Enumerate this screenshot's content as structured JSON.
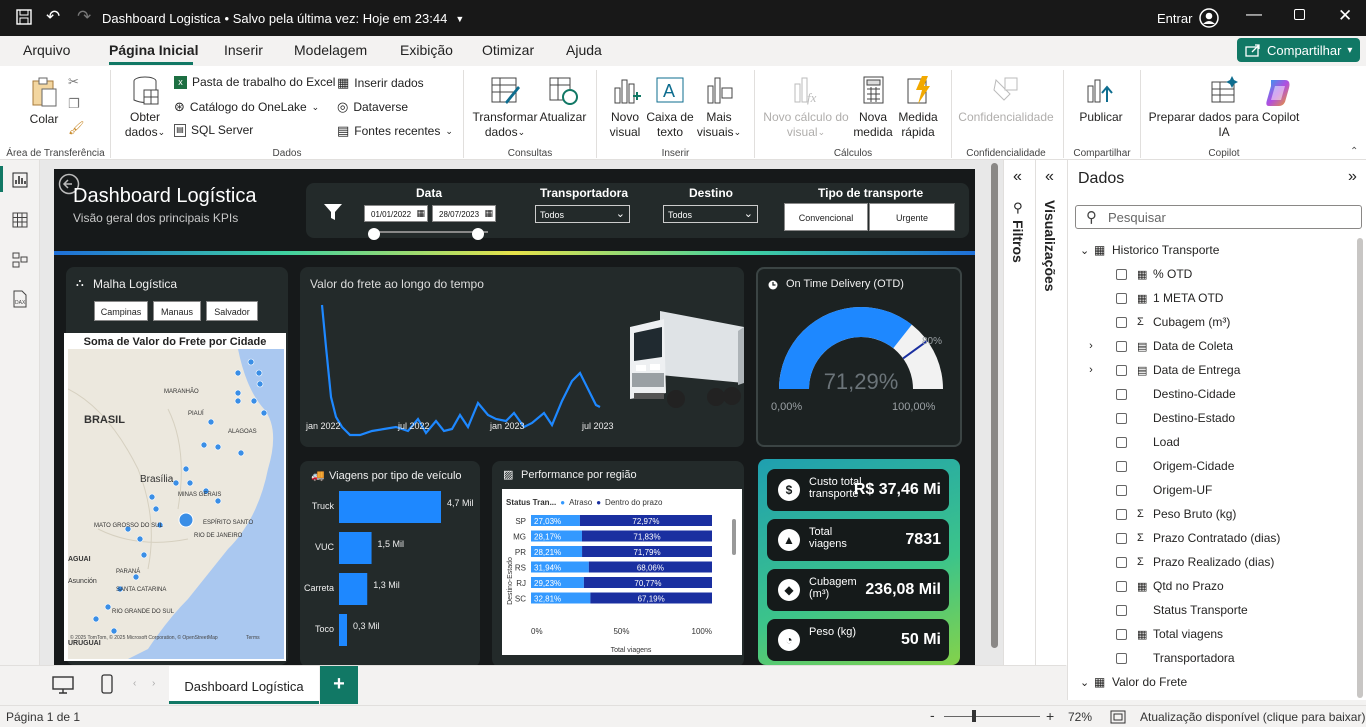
{
  "titlebar": {
    "title": "Dashboard Logistica",
    "saved": "• Salvo pela última vez: Hoje em 23:44",
    "signin": "Entrar"
  },
  "menu": {
    "items": [
      "Arquivo",
      "Página Inicial",
      "Inserir",
      "Modelagem",
      "Exibição",
      "Otimizar",
      "Ajuda"
    ],
    "active": "Página Inicial",
    "share": "Compartilhar"
  },
  "ribbon": {
    "paste": "Colar",
    "grp_clipboard": "Área de Transferência",
    "get_data_1": "Obter",
    "get_data_2": "dados",
    "excel": "Pasta de trabalho do Excel",
    "onelake": "Catálogo do OneLake",
    "sql": "SQL Server",
    "insert_data": "Inserir dados",
    "dataverse": "Dataverse",
    "recent": "Fontes recentes",
    "grp_data": "Dados",
    "transform_1": "Transformar",
    "transform_2": "dados",
    "refresh": "Atualizar",
    "grp_queries": "Consultas",
    "new_visual_1": "Novo",
    "new_visual_2": "visual",
    "textbox_1": "Caixa de",
    "textbox_2": "texto",
    "more_visuals_1": "Mais",
    "more_visuals_2": "visuais",
    "grp_insert": "Inserir",
    "new_calc_1": "Novo cálculo do",
    "new_calc_2": "visual",
    "new_measure_1": "Nova",
    "new_measure_2": "medida",
    "quick_measure_1": "Medida",
    "quick_measure_2": "rápida",
    "grp_calc": "Cálculos",
    "sensitivity": "Confidencialidade",
    "grp_sensitivity": "Confidencialidade",
    "publish": "Publicar",
    "grp_share": "Compartilhar",
    "copilot_1": "Preparar dados para Copilot",
    "copilot_2": "IA",
    "grp_copilot": "Copilot"
  },
  "report": {
    "title": "Dashboard Logística",
    "subtitle": "Visão geral dos principais KPIs",
    "filters": {
      "date_label": "Data",
      "date_from": "01/01/2022",
      "date_to": "28/07/2023",
      "carrier_label": "Transportadora",
      "carrier_value": "Todos",
      "dest_label": "Destino",
      "dest_value": "Todos",
      "type_label": "Tipo de transporte",
      "type_opt1": "Convencional",
      "type_opt2": "Urgente"
    },
    "map": {
      "card_title": "Malha Logística",
      "btns": [
        "Campinas",
        "Manaus",
        "Salvador"
      ],
      "title": "Soma de Valor do Frete por Cidade",
      "labels": [
        "BRASIL",
        "Brasília",
        "MARANHÃO",
        "PIAUÍ",
        "ALAGOAS",
        "MINAS GERAIS",
        "ESPÍRITO SANTO",
        "RIO DE JANEIRO",
        "MATO GROSSO DO SUL",
        "PARANÁ",
        "SANTA CATARINA",
        "RIO GRANDE DO SUL",
        "URUGUAI",
        "AGUAI",
        "Asunción",
        "URUGUAI"
      ],
      "copyright": "© 2025 TomTom, © 2025 Microsoft Corporation, © OpenStreetMap",
      "terms": "Terms"
    },
    "line": {
      "title": "Valor do frete ao longo do tempo",
      "ticks": [
        "jan 2022",
        "jul 2022",
        "jan 2023",
        "jul 2023"
      ]
    },
    "otd": {
      "title": "On Time Delivery (OTD)",
      "value": "71,29%",
      "min": "0,00%",
      "max": "100,00%",
      "target": "80%"
    },
    "vehicles": {
      "title": "Viagens por tipo de veículo",
      "rows": [
        {
          "label": "Truck",
          "value": "4,7 Mil"
        },
        {
          "label": "VUC",
          "value": "1,5 Mil"
        },
        {
          "label": "Carreta",
          "value": "1,3 Mil"
        },
        {
          "label": "Toco",
          "value": "0,3 Mil"
        }
      ]
    },
    "region": {
      "title": "Performance por região",
      "legend_title": "Status Tran...",
      "legend": [
        "Atraso",
        "Dentro do prazo"
      ],
      "ylabel": "Destino-Estado",
      "xlabel": "Total viagens",
      "xticks": [
        "0%",
        "50%",
        "100%"
      ],
      "rows": [
        {
          "uf": "SP",
          "a": "27,03%",
          "b": "72,97%"
        },
        {
          "uf": "MG",
          "a": "28,17%",
          "b": "71,83%"
        },
        {
          "uf": "PR",
          "a": "28,21%",
          "b": "71,79%"
        },
        {
          "uf": "RS",
          "a": "31,94%",
          "b": "68,06%"
        },
        {
          "uf": "RJ",
          "a": "29,23%",
          "b": "70,77%"
        },
        {
          "uf": "SC",
          "a": "32,81%",
          "b": "67,19%"
        }
      ]
    },
    "kpis": [
      {
        "label": "Custo total transporte",
        "value": "R$ 37,46 Mi",
        "icon": "dollar-icon"
      },
      {
        "label": "Total viagens",
        "value": "7831",
        "icon": "road-icon"
      },
      {
        "label": "Cubagem (m³)",
        "value": "236,08 Mil",
        "icon": "box-icon"
      },
      {
        "label": "Peso (kg)",
        "value": "50 Mi",
        "icon": "weight-icon"
      }
    ]
  },
  "panes": {
    "filtros": "Filtros",
    "visualizacoes": "Visualizações",
    "dados_title": "Dados",
    "search_placeholder": "Pesquisar",
    "fields": [
      {
        "name": "Historico Transporte",
        "kind": "table",
        "level": 0
      },
      {
        "name": "% OTD",
        "kind": "calc",
        "level": 1
      },
      {
        "name": "1 META OTD",
        "kind": "calc",
        "level": 1
      },
      {
        "name": "Cubagem (m³)",
        "kind": "sum",
        "level": 1
      },
      {
        "name": "Data de Coleta",
        "kind": "date",
        "level": 1,
        "expand": true
      },
      {
        "name": "Data de Entrega",
        "kind": "date",
        "level": 1,
        "expand": true
      },
      {
        "name": "Destino-Cidade",
        "kind": "text",
        "level": 1
      },
      {
        "name": "Destino-Estado",
        "kind": "text",
        "level": 1
      },
      {
        "name": "Load",
        "kind": "text",
        "level": 1
      },
      {
        "name": "Origem-Cidade",
        "kind": "text",
        "level": 1
      },
      {
        "name": "Origem-UF",
        "kind": "text",
        "level": 1
      },
      {
        "name": "Peso Bruto (kg)",
        "kind": "sum",
        "level": 1
      },
      {
        "name": "Prazo Contratado (dias)",
        "kind": "sum",
        "level": 1
      },
      {
        "name": "Prazo Realizado (dias)",
        "kind": "sum",
        "level": 1
      },
      {
        "name": "Qtd no Prazo",
        "kind": "calc",
        "level": 1
      },
      {
        "name": "Status Transporte",
        "kind": "text",
        "level": 1
      },
      {
        "name": "Total viagens",
        "kind": "calc",
        "level": 1
      },
      {
        "name": "Transportadora",
        "kind": "text",
        "level": 1
      },
      {
        "name": "Valor do Frete",
        "kind": "table",
        "level": 0
      }
    ]
  },
  "tabs": {
    "page": "Dashboard Logística",
    "add": "+"
  },
  "status": {
    "page": "Página 1 de 1",
    "zoom": "72%",
    "update": "Atualização disponível (clique para baixar)"
  },
  "colors": {
    "accent": "#117865",
    "bar_blue": "#1e88ff",
    "delay": "#3399ff",
    "ontime": "#1a2fa0",
    "dark": "#16191a"
  }
}
